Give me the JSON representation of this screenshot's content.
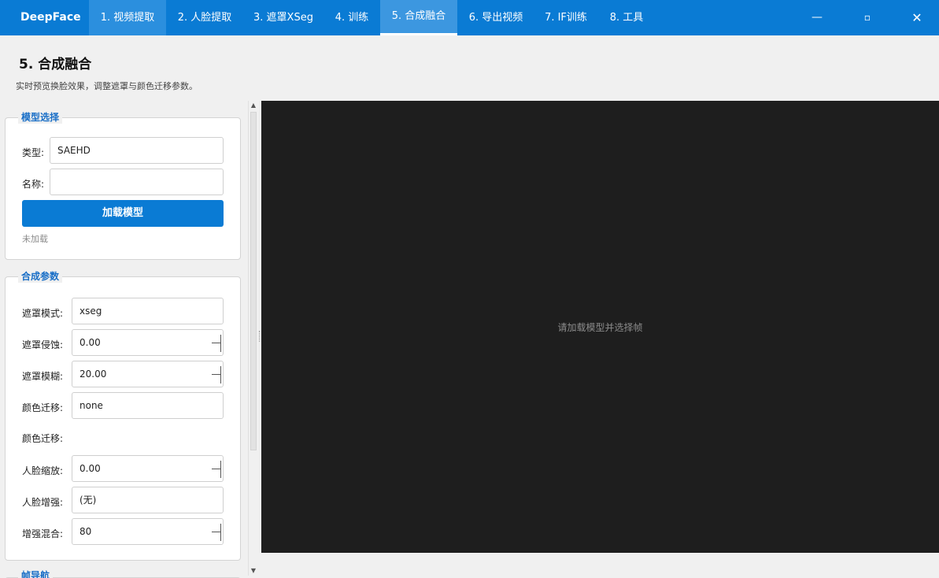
{
  "app": {
    "title": "DeepFace"
  },
  "tabs": [
    {
      "label": "1. 视频提取"
    },
    {
      "label": "2. 人脸提取"
    },
    {
      "label": "3. 遮罩XSeg"
    },
    {
      "label": "4. 训练"
    },
    {
      "label": "5. 合成融合"
    },
    {
      "label": "6. 导出视频"
    },
    {
      "label": "7. IF训练"
    },
    {
      "label": "8. 工具"
    }
  ],
  "window": {
    "minimize": "—",
    "maximize": "▫",
    "close": "✕"
  },
  "page": {
    "title": "5. 合成融合",
    "subtitle": "实时预览换脸效果，调整遮罩与颜色迁移参数。"
  },
  "model_group": {
    "title": "模型选择",
    "type_label": "类型:",
    "type_value": "SAEHD",
    "name_label": "名称:",
    "name_value": "",
    "load_button": "加载模型",
    "status": "未加载"
  },
  "params_group": {
    "title": "合成参数",
    "mask_mode_label": "遮罩模式:",
    "mask_mode_value": "xseg",
    "mask_erode_label": "遮罩侵蚀:",
    "mask_erode_value": "0.00",
    "mask_blur_label": "遮罩模糊:",
    "mask_blur_value": "20.00",
    "color_transfer_label": "颜色迁移:",
    "color_transfer_value": "none",
    "color_transfer_label2": "颜色迁移:",
    "face_scale_label": "人脸缩放:",
    "face_scale_value": "0.00",
    "face_enhance_label": "人脸增强:",
    "face_enhance_value": "(无)",
    "enhance_blend_label": "增强混合:",
    "enhance_blend_value": "80"
  },
  "next_group": {
    "title": "帧导航"
  },
  "preview": {
    "message": "请加载模型并选择帧",
    "background": "#1e1e1e"
  },
  "colors": {
    "accent": "#0a7bd4",
    "group_title": "#1a6fc7"
  }
}
